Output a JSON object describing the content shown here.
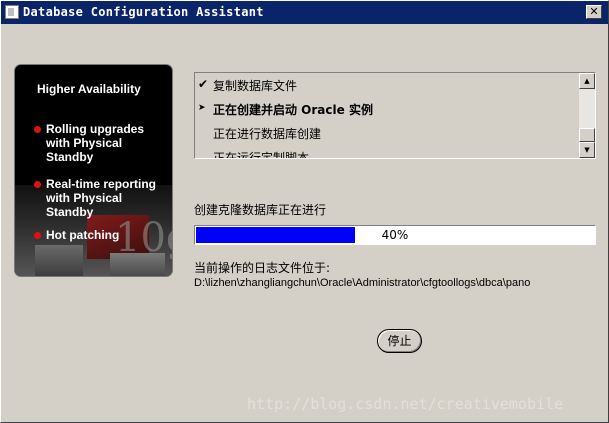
{
  "window": {
    "title": "Database Configuration Assistant",
    "close_glyph": "✕",
    "title_bar_color": "#0a246a"
  },
  "promo": {
    "heading": "Higher Availability",
    "items": [
      {
        "label": "Rolling upgrades with Physical Standby"
      },
      {
        "label": "Real-time reporting with Physical Standby"
      },
      {
        "label": "Hot patching"
      }
    ],
    "logo_text": "10g",
    "bullet_color": "#e01010"
  },
  "steps": [
    {
      "mark": "✔",
      "label": "复制数据库文件",
      "status": "done"
    },
    {
      "mark": "➤",
      "label": "正在创建并启动 Oracle 实例",
      "status": "in-progress"
    },
    {
      "mark": "",
      "label": "正在进行数据库创建",
      "status": "pending"
    },
    {
      "mark": "",
      "label": "正在运行定制脚本",
      "status": "pending"
    }
  ],
  "scrollbar": {
    "up_icon": "▲",
    "down_icon": "▼"
  },
  "progress": {
    "label": "创建克隆数据库正在进行",
    "value": 0.4,
    "text": "40%",
    "fill_color": "#0000ff"
  },
  "log": {
    "label": "当前操作的日志文件位于:",
    "path": "D:\\lizhen\\zhangliangchun\\Oracle\\Administrator\\cfgtoollogs\\dbca\\pano"
  },
  "buttons": {
    "stop_label": "停止"
  },
  "watermark": "http://blog.csdn.net/creativemobile"
}
